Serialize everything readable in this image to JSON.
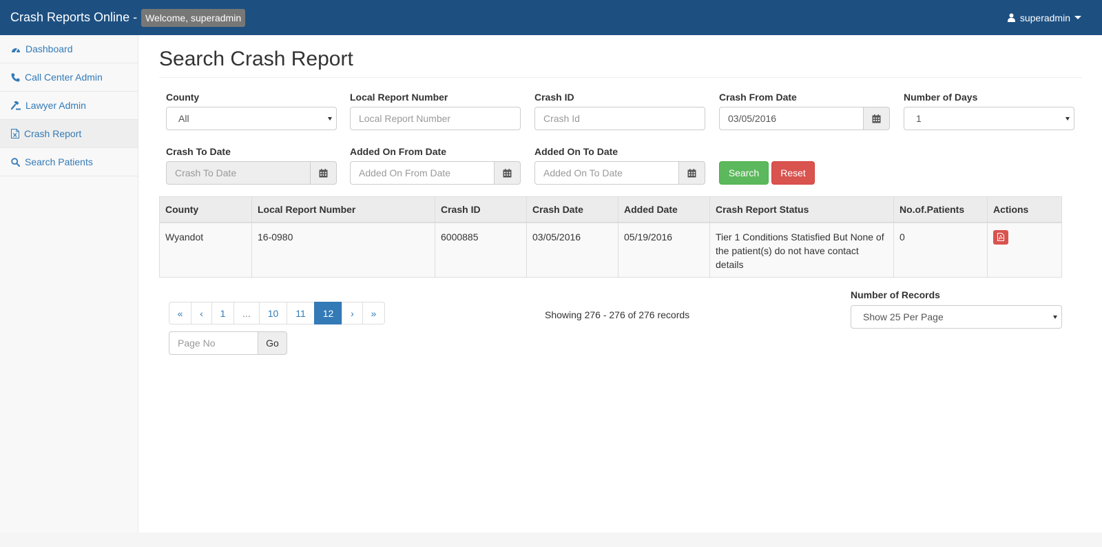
{
  "navbar": {
    "brand": "Crash Reports Online",
    "separator": "-",
    "welcome": "Welcome, superadmin",
    "user": "superadmin"
  },
  "sidebar": {
    "items": [
      {
        "label": "Dashboard",
        "icon": "dashboard-icon"
      },
      {
        "label": "Call Center Admin",
        "icon": "phone-icon"
      },
      {
        "label": "Lawyer Admin",
        "icon": "gavel-icon"
      },
      {
        "label": "Crash Report",
        "icon": "file-excel-icon",
        "active": true
      },
      {
        "label": "Search Patients",
        "icon": "search-icon"
      }
    ]
  },
  "page": {
    "title": "Search Crash Report"
  },
  "filters": {
    "county": {
      "label": "County",
      "value": "All"
    },
    "local_report_number": {
      "label": "Local Report Number",
      "placeholder": "Local Report Number"
    },
    "crash_id": {
      "label": "Crash ID",
      "placeholder": "Crash Id"
    },
    "crash_from_date": {
      "label": "Crash From Date",
      "value": "03/05/2016"
    },
    "number_of_days": {
      "label": "Number of Days",
      "value": "1"
    },
    "crash_to_date": {
      "label": "Crash To Date",
      "placeholder": "Crash To Date"
    },
    "added_on_from_date": {
      "label": "Added On From Date",
      "placeholder": "Added On From Date"
    },
    "added_on_to_date": {
      "label": "Added On To Date",
      "placeholder": "Added On To Date"
    },
    "search_label": "Search",
    "reset_label": "Reset"
  },
  "table": {
    "headers": [
      "County",
      "Local Report Number",
      "Crash ID",
      "Crash Date",
      "Added Date",
      "Crash Report Status",
      "No.of.Patients",
      "Actions"
    ],
    "rows": [
      {
        "county": "Wyandot",
        "local_report_number": "16-0980",
        "crash_id": "6000885",
        "crash_date": "03/05/2016",
        "added_date": "05/19/2016",
        "status": "Tier 1 Conditions Statisfied But None of the patient(s) do not have contact details",
        "patients": "0",
        "action_icon": "pdf-icon"
      }
    ]
  },
  "pagination": {
    "first": "«",
    "prev": "‹",
    "pages": [
      "1",
      "...",
      "10",
      "11",
      "12"
    ],
    "active_page": "12",
    "next": "›",
    "last": "»",
    "showing": "Showing 276 - 276 of 276 records",
    "page_no_placeholder": "Page No",
    "go_label": "Go",
    "records_label": "Number of Records",
    "records_value": "Show 25 Per Page"
  },
  "colors": {
    "navbar": "#1d5081",
    "link": "#337ab7",
    "success": "#5cb85c",
    "danger": "#d9534f"
  }
}
